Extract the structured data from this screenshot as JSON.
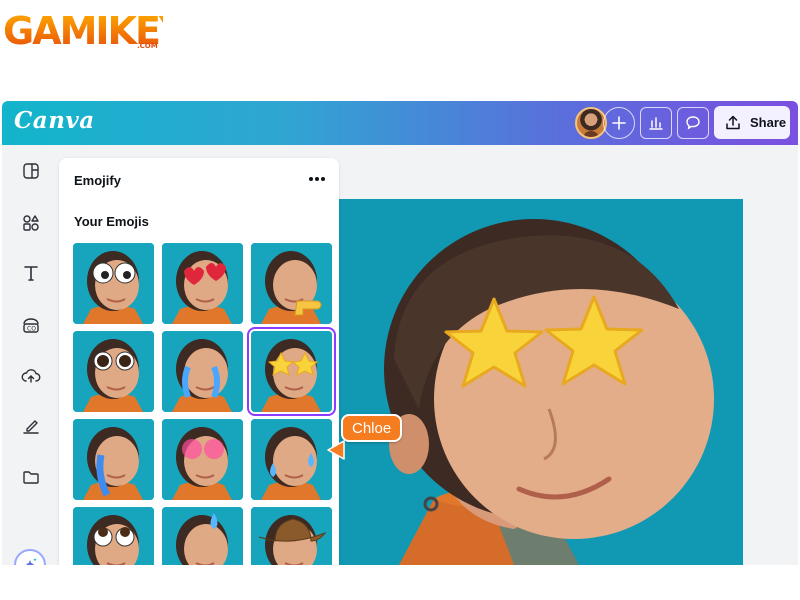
{
  "watermark": {
    "text": "GAMIKEY",
    "suffix": ".COM"
  },
  "app": {
    "brand": "Canva",
    "share_label": "Share",
    "colors": {
      "accent": "#8b3dff",
      "teal": "#12b5cb",
      "orange": "#f57c1f"
    }
  },
  "toolbar": {
    "icons": [
      "avatar",
      "add-icon",
      "insights-chart-icon",
      "comment-icon",
      "upload-share-icon"
    ]
  },
  "leftrail": {
    "icons": [
      "layout-icon",
      "elements-icon",
      "text-icon",
      "brand-icon",
      "uploads-icon",
      "draw-icon",
      "projects-icon",
      "magic-icon"
    ]
  },
  "panel": {
    "title": "Emojify",
    "more_icon": "ellipsis-icon",
    "section_title": "Your Emojis",
    "emojis": [
      "googly-eyes",
      "heart-eyes",
      "pointing-hand",
      "big-eyes",
      "crying",
      "star-eyes",
      "tears-streaming",
      "angry-red",
      "sweat-drops",
      "rolling-eyes",
      "sweat-drop",
      "cowboy-hat"
    ],
    "selected_index": 5
  },
  "collab": {
    "name": "Chloe"
  }
}
